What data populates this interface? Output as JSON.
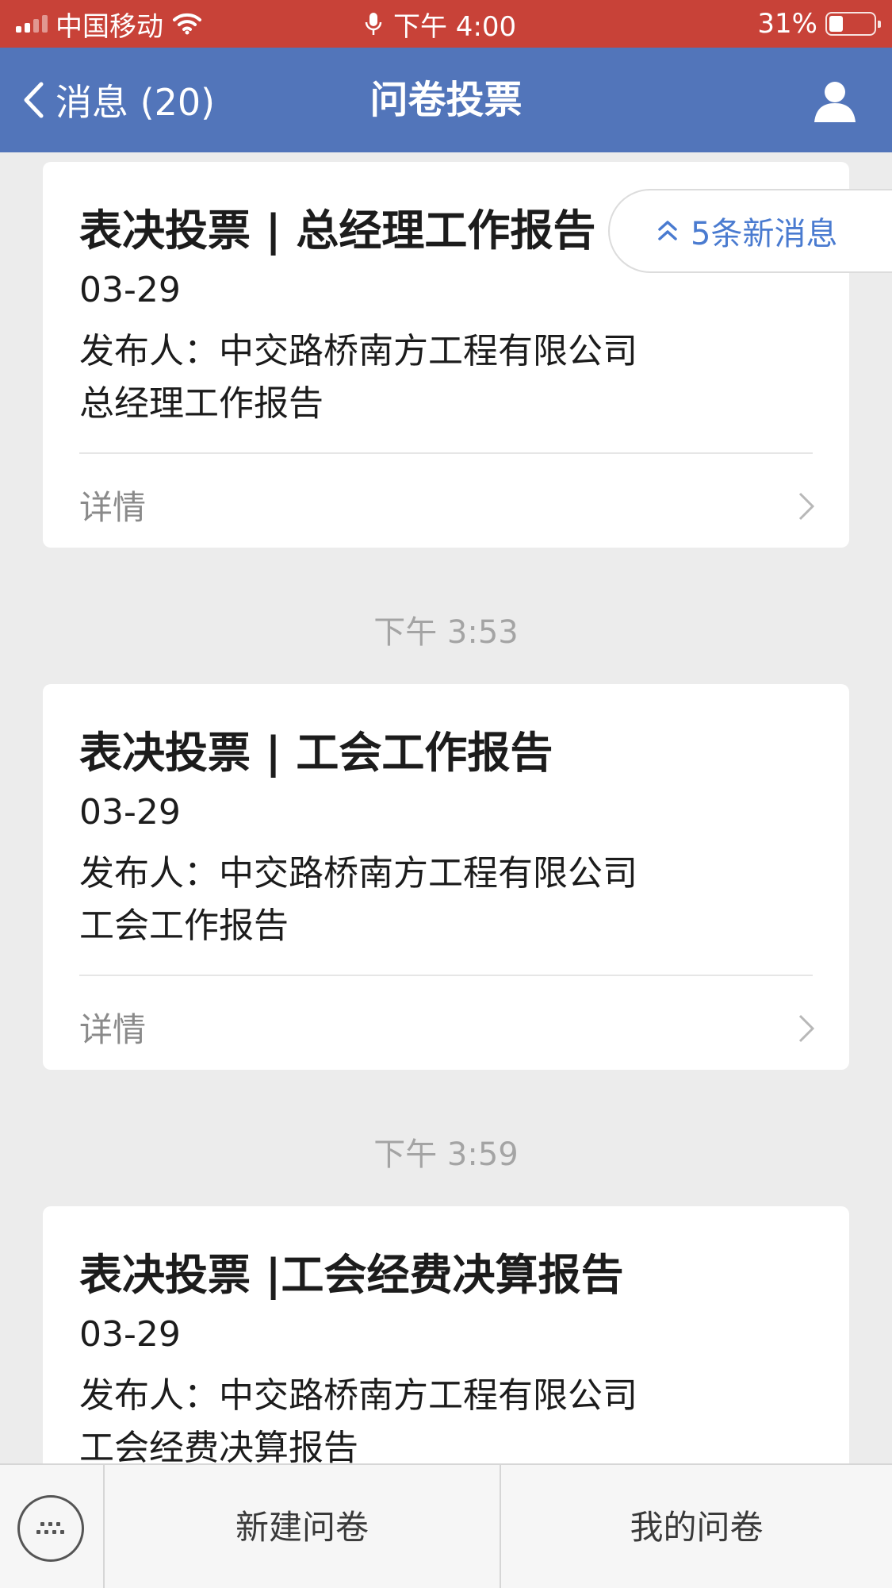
{
  "status_bar": {
    "carrier": "中国移动",
    "time": "下午 4:00",
    "battery": "31%",
    "battery_level": 0.31
  },
  "nav": {
    "back_label": "消息 (20)",
    "title": "问卷投票"
  },
  "new_messages": "5条新消息",
  "cards": [
    {
      "title": "表决投票 | 总经理工作报告",
      "date": "03-29",
      "publisher": "发布人：中交路桥南方工程有限公司",
      "description": "总经理工作报告",
      "detail_label": "详情"
    },
    {
      "title": "表决投票 | 工会工作报告",
      "date": "03-29",
      "publisher": "发布人：中交路桥南方工程有限公司",
      "description": "工会工作报告",
      "detail_label": "详情"
    },
    {
      "title": "表决投票 |工会经费决算报告",
      "date": "03-29",
      "publisher": "发布人：中交路桥南方工程有限公司",
      "description": "工会经费决算报告"
    }
  ],
  "timestamps": [
    "下午 3:53",
    "下午 3:59"
  ],
  "bottom_bar": {
    "new_survey": "新建问卷",
    "my_surveys": "我的问卷"
  },
  "colors": {
    "status_bar": "#c84238",
    "nav_bar": "#5275ba",
    "link_blue": "#4a7bd0",
    "background": "#ececec"
  },
  "icons": {
    "signal": "signal-icon",
    "wifi": "wifi-icon",
    "mic": "microphone-icon",
    "battery": "battery-icon",
    "back": "chevron-left-icon",
    "user": "user-icon",
    "new_messages": "double-chevron-up-icon",
    "detail": "chevron-right-icon",
    "keyboard": "keyboard-icon"
  }
}
